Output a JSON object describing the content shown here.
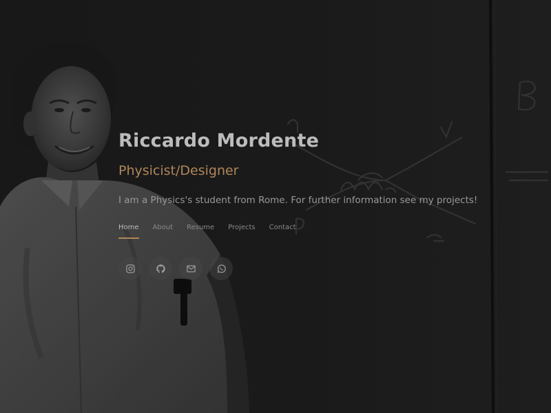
{
  "header": {
    "name": "Riccardo Mordente",
    "role": "Physicist/Designer",
    "intro": "I am a Physics's student from Rome. For further information see my projects!"
  },
  "nav": {
    "items": [
      {
        "label": "Home",
        "active": true
      },
      {
        "label": "About",
        "active": false
      },
      {
        "label": "Resume",
        "active": false
      },
      {
        "label": "Projects",
        "active": false
      },
      {
        "label": "Contact",
        "active": false
      }
    ]
  },
  "social": {
    "icons": [
      "instagram-icon",
      "github-icon",
      "mail-icon",
      "whatsapp-icon"
    ]
  },
  "colors": {
    "accent": "#b0875a",
    "name_text": "#bcbcbc",
    "body_text": "#9a9a9a",
    "background": "#161616"
  }
}
